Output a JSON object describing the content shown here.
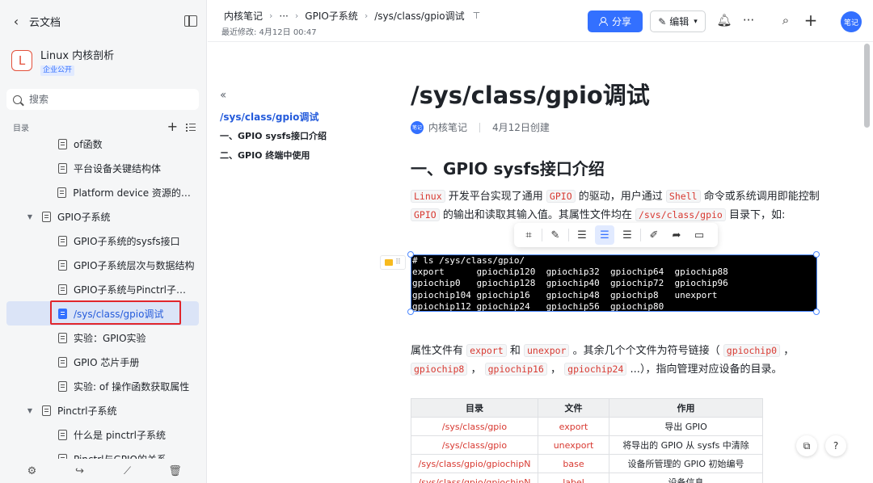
{
  "sidebar": {
    "back_label": "云文档",
    "space": {
      "logo_letter": "L",
      "name": "Linux 内核剖析",
      "badge": "企业公开"
    },
    "search_placeholder": "搜索",
    "toc_label": "目录",
    "items": [
      {
        "label": "of函数",
        "level": 2
      },
      {
        "label": "平台设备关键结构体",
        "level": 2
      },
      {
        "label": "Platform device 资源的获取",
        "level": 2
      },
      {
        "label": "GPIO子系统",
        "level": 1,
        "expanded": true
      },
      {
        "label": "GPIO子系统的sysfs接口",
        "level": 2
      },
      {
        "label": "GPIO子系统层次与数据结构",
        "level": 2
      },
      {
        "label": "GPIO子系统与Pinctrl子系...",
        "level": 2
      },
      {
        "label": "/sys/class/gpio调试",
        "level": 2,
        "active": true
      },
      {
        "label": "实验：GPIO实验",
        "level": 2
      },
      {
        "label": "GPIO 芯片手册",
        "level": 2
      },
      {
        "label": "实验: of 操作函数获取属性",
        "level": 2
      },
      {
        "label": "Pinctrl子系统",
        "level": 1,
        "expanded": true
      },
      {
        "label": "什么是 pinctrl子系统",
        "level": 2
      },
      {
        "label": "Pinctrl与GPIO的关系",
        "level": 2
      }
    ],
    "bottom_icons": [
      "settings-icon",
      "share-icon",
      "chart-icon",
      "trash-icon"
    ]
  },
  "header": {
    "breadcrumbs": [
      "内核笔记",
      "···",
      "GPIO子系统",
      "/sys/class/gpio调试"
    ],
    "modified": "最近修改: 4月12日 00:47",
    "share_label": "分享",
    "edit_label": "编辑",
    "avatar_label": "笔记"
  },
  "outline": {
    "items": [
      "/sys/class/gpio调试",
      "一、GPIO sysfs接口介绍",
      "二、GPIO 终端中使用"
    ]
  },
  "doc": {
    "title": "/sys/class/gpio调试",
    "author_avatar": "笔记",
    "author": "内核笔记",
    "created": "4月12日创建",
    "h1": "一、GPIO sysfs接口介绍",
    "p1": {
      "t1": "开发平台实现了通用",
      "t2": "的驱动，用户通过",
      "t3": "命令或系统调用即能控制",
      "t4": "的输出和读取其输入值。其属性文件均在",
      "t5": "目录下，如:",
      "c1": "Linux",
      "c2": "GPIO",
      "c3": "Shell",
      "c4": "GPIO",
      "c5": "/svs/class/gpio"
    },
    "terminal": "# ls /sys/class/gpio/\nexport      gpiochip120  gpiochip32  gpiochip64  gpiochip88\ngpiochip0   gpiochip128  gpiochip40  gpiochip72  gpiochip96\ngpiochip104 gpiochip16   gpiochip48  gpiochip8   unexport\ngpiochip112 gpiochip24   gpiochip56  gpiochip80",
    "p2": {
      "t1": "属性文件有",
      "t2": "和",
      "t3": "。其余几个个文件为符号链接（",
      "t4": "，",
      "t5": "，",
      "t6": "，",
      "t7": "...），指向管理对应设备的目录。",
      "c1": "export",
      "c2": "unexpor",
      "c3": "gpiochip0",
      "c4": "gpiochip8",
      "c5": "gpiochip16",
      "c6": "gpiochip24"
    },
    "table": {
      "headers": [
        "目录",
        "文件",
        "作用"
      ],
      "rows": [
        [
          "/sys/class/gpio",
          "export",
          "导出 GPIO"
        ],
        [
          "/sys/class/gpio",
          "unexport",
          "将导出的 GPIO 从 sysfs 中清除"
        ],
        [
          "/sys/class/gpio/gpiochipN",
          "base",
          "设备所管理的 GPIO 初始编号"
        ],
        [
          "/sys/class/gpio/gpiochipN",
          "label",
          "设备信息"
        ]
      ]
    }
  }
}
